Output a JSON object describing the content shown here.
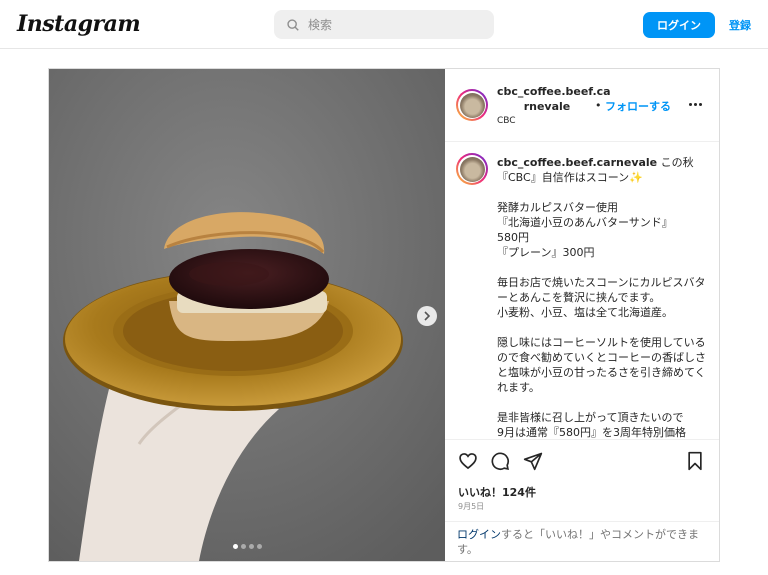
{
  "nav": {
    "logo": "Instagram",
    "search_placeholder": "検索",
    "login_label": "ログイン",
    "signup_label": "登録"
  },
  "post": {
    "username_line1": "cbc_coffee.beef.ca",
    "username_line2": "rnevale",
    "subtitle": "CBC",
    "follow_separator": "•",
    "follow_label": "フォローする",
    "caption_user": "cbc_coffee.beef.carnevale",
    "caption_text": " この秋\n『CBC』自信作はスコーン✨\n\n発酵カルピスバター使用\n『北海道小豆のあんバターサンド』\n580円\n『プレーン』300円\n\n毎日お店で焼いたスコーンにカルピスバターとあんこを贅沢に挟んでます。\n小麦粉、小豆、塩は全て北海道産。\n\n隠し味にはコーヒーソルトを使用しているので食べ勧めていくとコーヒーの香ばしさと塩味が小豆の甘ったるさを引き締めてくれます。\n\n是非皆様に召し上がって頂きたいので\n9月は通常『580円』を3周年特別価格",
    "likes": "いいね！124件",
    "date": "9月5日",
    "login_prompt_link": "ログイン",
    "login_prompt_rest": "すると「いいね！」やコメントができます。",
    "carousel_count": 4,
    "carousel_active": 0
  },
  "colors": {
    "accent": "#0095f6",
    "plate": "#a87a1c",
    "background_wall": "#6f6f6f"
  }
}
